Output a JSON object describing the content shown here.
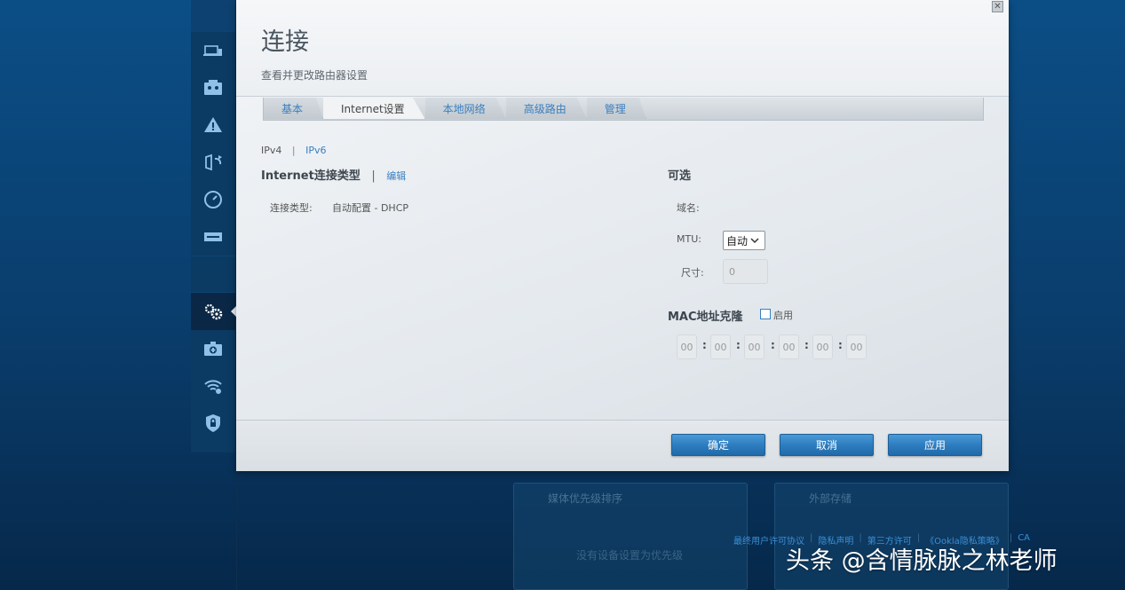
{
  "dialog": {
    "title": "连接",
    "subtitle": "查看并更改路由器设置",
    "close_glyph": "✕"
  },
  "tabs": [
    {
      "label": "基本",
      "active": false
    },
    {
      "label": "Internet设置",
      "active": true
    },
    {
      "label": "本地网络",
      "active": false
    },
    {
      "label": "高级路由",
      "active": false
    },
    {
      "label": "管理",
      "active": false
    }
  ],
  "ip_tabs": {
    "ipv4": "IPv4",
    "separator": "|",
    "ipv6": "IPv6"
  },
  "internet": {
    "title": "Internet连接类型",
    "separator": "|",
    "edit_label": "编辑",
    "conn_type_label": "连接类型:",
    "conn_type_value": "自动配置 - DHCP"
  },
  "optional": {
    "title": "可选",
    "domain_label": "域名:",
    "mtu_label": "MTU:",
    "mtu_value": "自动",
    "size_label": "尺寸:",
    "size_value": "0"
  },
  "mac_clone": {
    "title": "MAC地址克隆",
    "enable_label": "启用",
    "enabled": false,
    "octets": [
      "00",
      "00",
      "00",
      "00",
      "00",
      "00"
    ],
    "colon": ":"
  },
  "buttons": {
    "ok": "确定",
    "cancel": "取消",
    "apply": "应用"
  },
  "background": {
    "widget1_title": "媒体优先级排序",
    "widget1_body": "没有设备设置为优先级",
    "widget2_title": "外部存储"
  },
  "footer_links": [
    "最终用户许可协议",
    "隐私声明",
    "第三方许可",
    "《Ookla隐私策略》",
    "CA"
  ],
  "footer_sep": "|",
  "watermark": "头条 @含情脉脉之林老师",
  "colors": {
    "accent": "#2e7dc0",
    "link": "#3a7fbf",
    "sidebar": "#0b3a62"
  }
}
